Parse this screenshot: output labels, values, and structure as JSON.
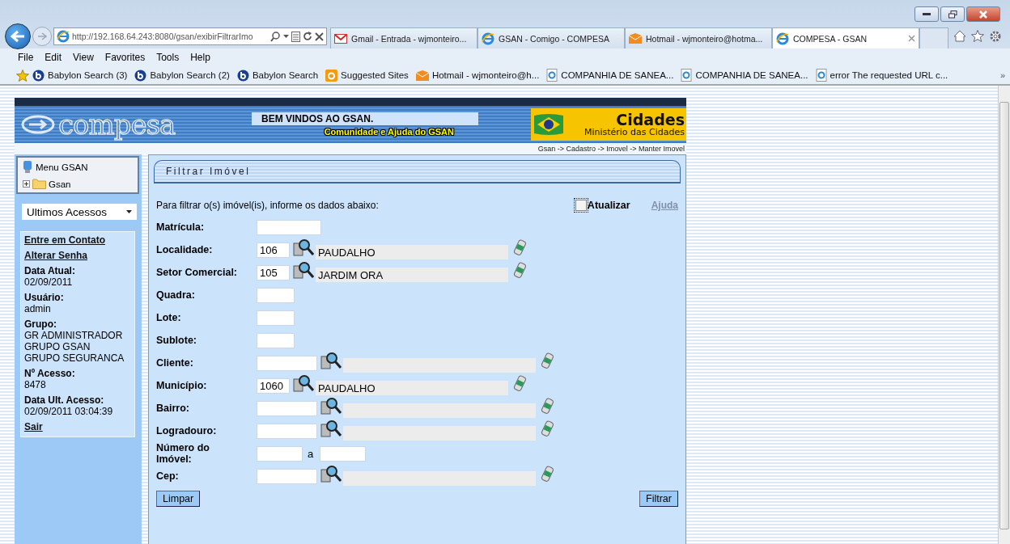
{
  "browser": {
    "address": "http://192.168.64.243:8080/gsan/exibirFiltrarImo",
    "tabs": [
      {
        "title": "Gmail - Entrada - wjmonteiro...",
        "kind": "gmail",
        "selected": false
      },
      {
        "title": "GSAN - Comigo - COMPESA",
        "kind": "ie",
        "selected": false
      },
      {
        "title": "Hotmail - wjmonteiro@hotma...",
        "kind": "hotmail",
        "selected": false
      },
      {
        "title": "COMPESA - GSAN",
        "kind": "ie",
        "selected": true
      }
    ],
    "menu": [
      "File",
      "Edit",
      "View",
      "Favorites",
      "Tools",
      "Help"
    ],
    "favorites": [
      {
        "label": "Babylon Search (3)",
        "kind": "babylon"
      },
      {
        "label": "Babylon Search (2)",
        "kind": "babylon"
      },
      {
        "label": "Babylon Search",
        "kind": "babylon"
      },
      {
        "label": "Suggested Sites",
        "kind": "suggested"
      },
      {
        "label": "Hotmail - wjmonteiro@h...",
        "kind": "hotmail"
      },
      {
        "label": "COMPANHIA DE SANEA...",
        "kind": "ie"
      },
      {
        "label": "COMPANHIA DE SANEA...",
        "kind": "ie"
      },
      {
        "label": "error The requested URL c...",
        "kind": "ie"
      }
    ],
    "more": "»"
  },
  "header": {
    "logo": "compesa",
    "welcome": "BEM VINDOS AO GSAN.",
    "community_link": "Comunidade e Ajuda do GSAN",
    "cidades_title": "Cidades",
    "cidades_subtitle": "Ministério das Cidades",
    "breadcrumb": "Gsan -> Cadastro -> Imovel -> Manter Imovel"
  },
  "sidebar": {
    "menu_title": "Menu GSAN",
    "tree": [
      {
        "label": "Gsan",
        "expanded": false
      }
    ],
    "recent_select": "Ultimos Acessos",
    "links": [
      "Entre em Contato",
      "Alterar Senha"
    ],
    "info": [
      {
        "label": "Data Atual:",
        "lines": [
          "02/09/2011"
        ]
      },
      {
        "label": "Usuário:",
        "lines": [
          "admin"
        ]
      },
      {
        "label": "Grupo:",
        "lines": [
          "GR ADMINISTRADOR",
          "GRUPO GSAN",
          "GRUPO SEGURANCA"
        ]
      },
      {
        "label": "Nº Acesso:",
        "lines": [
          "8478"
        ]
      },
      {
        "label": "Data Ult. Acesso:",
        "lines": [
          "02/09/2011 03:04:39"
        ]
      }
    ],
    "logout": "Sair"
  },
  "form": {
    "title": "Filtrar Imóvel",
    "instructions": "Para filtrar o(s) imóvel(is), informe os dados abaixo:",
    "update": {
      "label": "Atualizar",
      "checked": false
    },
    "help": "Ajuda",
    "fields": [
      {
        "label": "Matrícula:",
        "kind": "text"
      },
      {
        "label": "Localidade:",
        "kind": "lookup",
        "value": "106",
        "description": "PAUDALHO"
      },
      {
        "label": "Setor Comercial:",
        "kind": "lookup",
        "value": "105",
        "description": "JARDIM ORA"
      },
      {
        "label": "Quadra:",
        "kind": "short"
      },
      {
        "label": "Lote:",
        "kind": "short"
      },
      {
        "label": "Sublote:",
        "kind": "short"
      },
      {
        "label": "Cliente:",
        "kind": "lookup"
      },
      {
        "label": "Município:",
        "kind": "lookup",
        "value": "1060",
        "description": "PAUDALHO"
      },
      {
        "label": "Bairro:",
        "kind": "lookup"
      },
      {
        "label": "Logradouro:",
        "kind": "lookup"
      },
      {
        "label": "Número do Imóvel:",
        "kind": "range",
        "separator": "a"
      },
      {
        "label": "Cep:",
        "kind": "lookup"
      }
    ],
    "clear_button": "Limpar",
    "submit_button": "Filtrar"
  }
}
